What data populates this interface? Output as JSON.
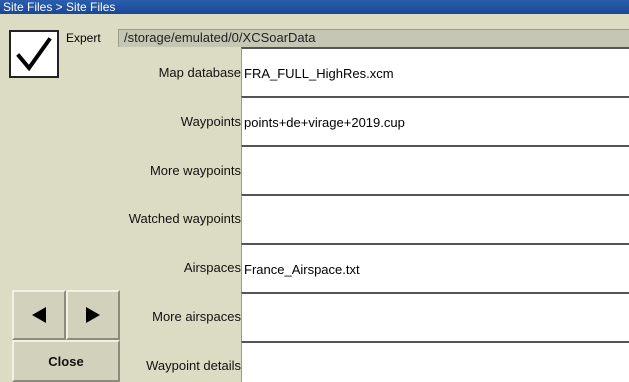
{
  "window": {
    "title": "Site Files > Site Files"
  },
  "expert": {
    "label": "Expert",
    "checked": true
  },
  "data_path": "/storage/emulated/0/XCSoarData",
  "rows": [
    {
      "label": "Map database",
      "value": "FRA_FULL_HighRes.xcm"
    },
    {
      "label": "Waypoints",
      "value": "points+de+virage+2019.cup"
    },
    {
      "label": "More waypoints",
      "value": ""
    },
    {
      "label": "Watched waypoints",
      "value": ""
    },
    {
      "label": "Airspaces",
      "value": "France_Airspace.txt"
    },
    {
      "label": "More airspaces",
      "value": ""
    },
    {
      "label": "Waypoint details",
      "value": ""
    }
  ],
  "buttons": {
    "prev_icon": "arrow-left-icon",
    "next_icon": "arrow-right-icon",
    "close_label": "Close"
  },
  "colors": {
    "background": "#dcdcc4",
    "titlebar": "#1a4794",
    "field": "#ffffff"
  }
}
